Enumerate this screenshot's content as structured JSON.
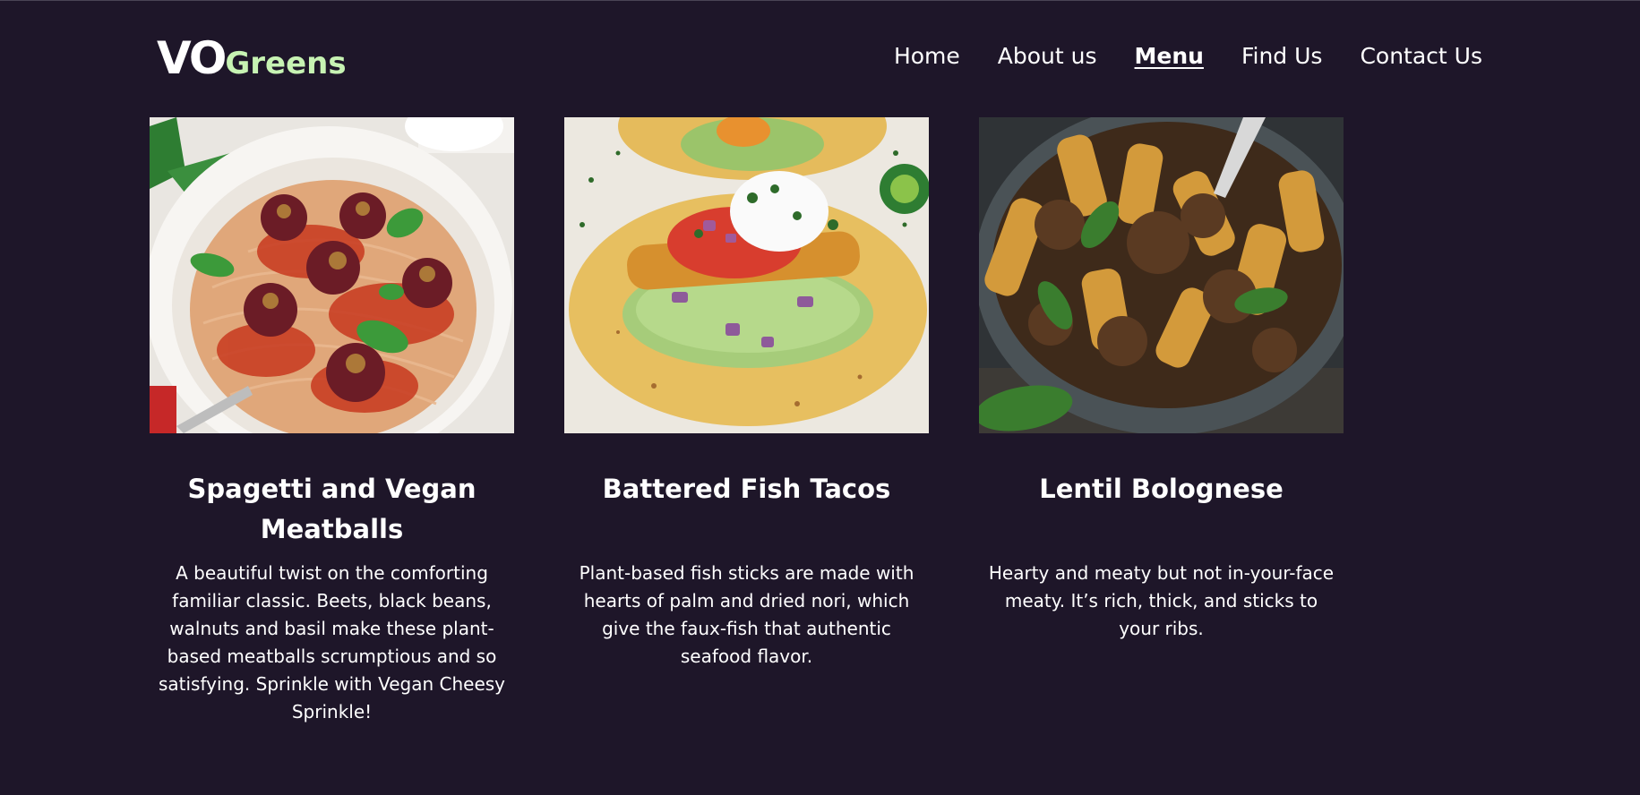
{
  "brand": {
    "logo_main": "VO",
    "logo_sub": "Greens"
  },
  "nav": {
    "items": [
      "Home",
      "About us",
      "Menu",
      "Find Us",
      "Contact Us"
    ],
    "active": "Menu"
  },
  "menu_items": [
    {
      "title": "Spagetti and Vegan Meatballs",
      "description": "A beautiful twist on the comforting familiar classic. Beets, black beans, walnuts and basil make these plant-based meatballs scrumptious and so satisfying. Sprinkle with Vegan Cheesy Sprinkle!",
      "image": "spaghetti-meatballs-photo"
    },
    {
      "title": "Battered Fish Tacos",
      "description": "Plant-based fish sticks are made with hearts of palm and dried nori, which give the faux-fish that authentic seafood flavor.",
      "image": "fish-tacos-photo"
    },
    {
      "title": "Lentil Bolognese",
      "description": "Hearty and meaty but not in-your-face meaty. It’s rich, thick, and sticks to your ribs.",
      "image": "lentil-bolognese-photo"
    }
  ],
  "colors": {
    "background": "#1e1629",
    "logo_accent": "#c7f3b3",
    "text": "#ffffff"
  }
}
